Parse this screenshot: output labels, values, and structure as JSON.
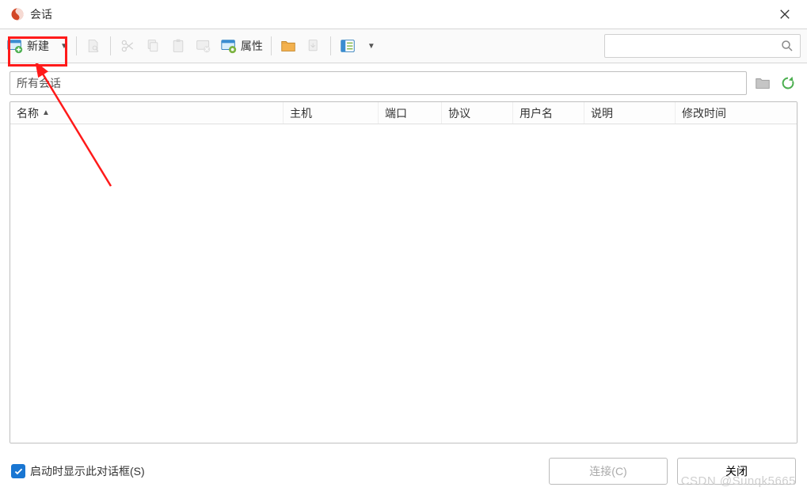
{
  "title": "会话",
  "toolbar": {
    "new_label": "新建",
    "props_label": "属性"
  },
  "search": {
    "placeholder": ""
  },
  "path": {
    "value": "所有会话"
  },
  "columns": {
    "name": "名称",
    "host": "主机",
    "port": "端口",
    "protocol": "协议",
    "user": "用户名",
    "desc": "说明",
    "mtime": "修改时间"
  },
  "footer": {
    "startup_checkbox_label": "启动时显示此对话框(S)",
    "startup_checked": true,
    "connect_label": "连接(C)",
    "close_label": "关闭"
  },
  "watermark": "CSDN @Sunqk5665"
}
